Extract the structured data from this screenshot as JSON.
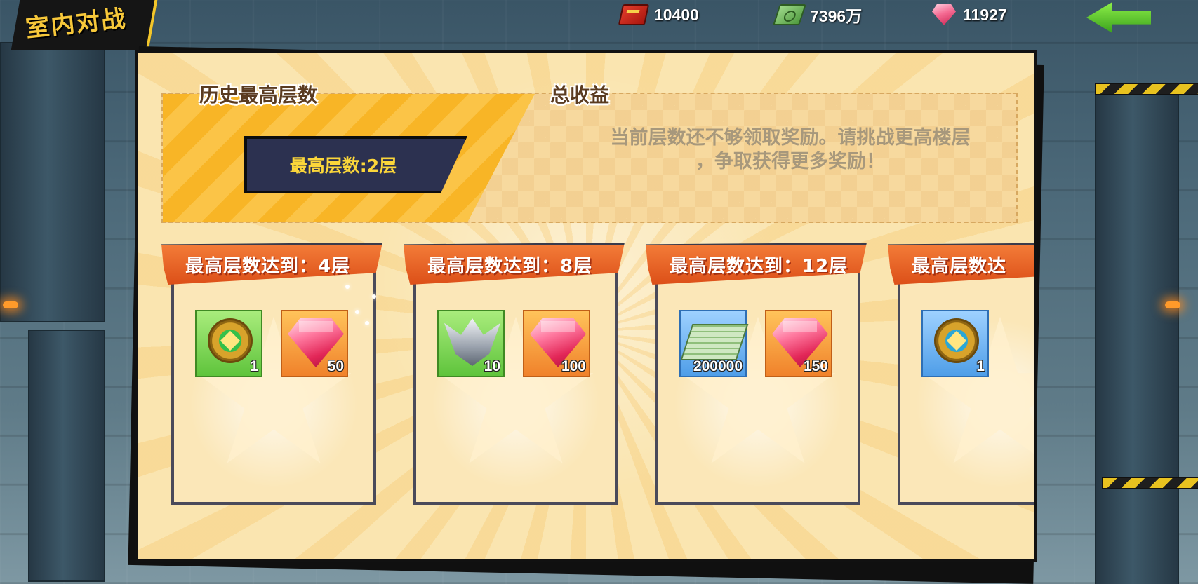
{
  "title": "室内对战",
  "resources": [
    {
      "icon": "red-book-icon",
      "value": "10400"
    },
    {
      "icon": "cash-stack-icon",
      "value": "7396万"
    },
    {
      "icon": "pink-gem-icon",
      "value": "11927"
    }
  ],
  "summary": {
    "history_label": "历史最高层数",
    "max_floor": "最高层数:2层",
    "total_label": "总收益",
    "notice_line1": "当前层数还不够领取奖励。请挑战更高楼层",
    "notice_line2": "，争取获得更多奖励！"
  },
  "cards": [
    {
      "title": "最高层数达到：4层",
      "rewards": [
        {
          "icon": "green-medal-icon",
          "bg": "green",
          "qty": "1"
        },
        {
          "icon": "pink-gem-icon",
          "bg": "orange",
          "qty": "50"
        }
      ]
    },
    {
      "title": "最高层数达到：8层",
      "rewards": [
        {
          "icon": "silver-wings-badge-icon",
          "bg": "green",
          "qty": "10"
        },
        {
          "icon": "pink-gem-icon",
          "bg": "orange",
          "qty": "100"
        }
      ]
    },
    {
      "title": "最高层数达到：12层",
      "rewards": [
        {
          "icon": "cash-stack-icon",
          "bg": "blue",
          "qty": "200000"
        },
        {
          "icon": "pink-gem-icon",
          "bg": "orange",
          "qty": "150"
        }
      ]
    },
    {
      "title": "最高层数达",
      "rewards": [
        {
          "icon": "blue-medal-icon",
          "bg": "blue",
          "qty": "1"
        }
      ]
    }
  ],
  "colors": {
    "panel_bg": "#fae5b0",
    "banner": "#e8602a",
    "gold_text": "#fbd63a",
    "back_button": "#5ccf2e"
  }
}
